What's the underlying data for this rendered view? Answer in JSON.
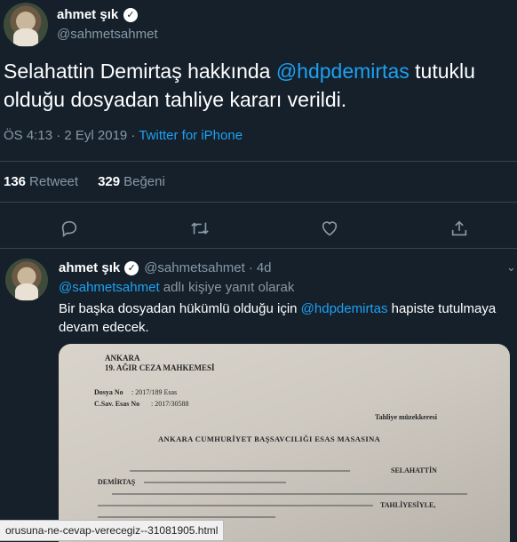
{
  "main_tweet": {
    "author_name": "ahmet şık",
    "author_handle": "@sahmetsahmet",
    "text_before": "Selahattin Demirtaş hakkında ",
    "mention": "@hdpdemirtas",
    "text_after": " tutuklu olduğu dosyadan tahliye kararı verildi.",
    "timestamp": "ÖS 4:13 · 2 Eyl 2019 · ",
    "source": "Twitter for iPhone",
    "retweet_count": "136",
    "retweet_label": "Retweet",
    "like_count": "329",
    "like_label": "Beğeni",
    "actions": [
      "reply-icon",
      "retweet-icon",
      "like-icon",
      "share-icon"
    ]
  },
  "reply_tweet": {
    "author_name": "ahmet şık",
    "author_handle": "@sahmetsahmet",
    "age": "4d",
    "replying_mention": "@sahmetsahmet",
    "replying_suffix": " adlı kişiye yanıt olarak",
    "text_before": "Bir başka dosyadan hükümlü olduğu için ",
    "mention": "@hdpdemirtas",
    "text_after": " hapiste tutulmaya devam edecek.",
    "document": {
      "line1": "ANKARA",
      "line2": "19. AĞIR CEZA MAHKEMESİ",
      "dosya_label": "Dosya No",
      "dosya_value": ": 2017/189 Esas",
      "csav_label": "C.Sav. Esas No",
      "csav_value": ": 2017/30588",
      "tahliye": "Tahliye müzekkeresi",
      "heading": "ANKARA CUMHURİYET BAŞSAVCILIĞI ESAS MASASINA",
      "name_line": "SELAHATTİN",
      "name_line2": "DEMİRTAŞ",
      "tahliyesiyle": "TAHLİYESİYLE,"
    }
  },
  "status_bar": {
    "url": "orusuna-ne-cevap-verecegiz--31081905.html"
  }
}
